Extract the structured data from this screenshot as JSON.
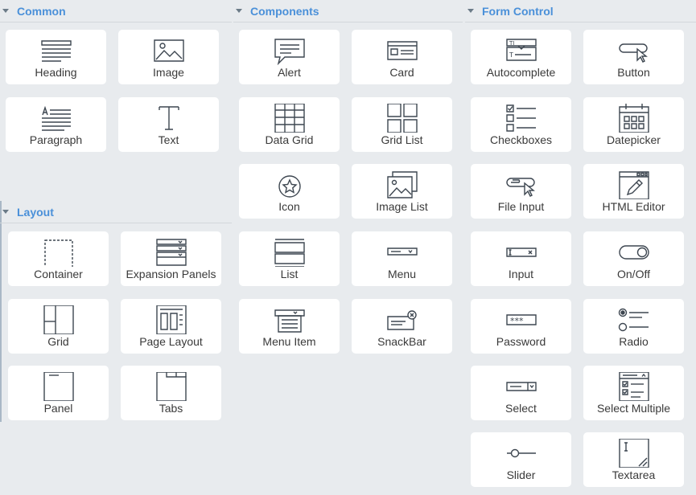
{
  "sections": {
    "common": "Common",
    "components": "Components",
    "form_control": "Form Control",
    "layout": "Layout"
  },
  "common": [
    "Heading",
    "Image",
    "Paragraph",
    "Text"
  ],
  "layout": [
    "Container",
    "Expansion Panels",
    "Grid",
    "Page Layout",
    "Panel",
    "Tabs"
  ],
  "components": [
    "Alert",
    "Card",
    "Data Grid",
    "Grid List",
    "Icon",
    "Image List",
    "List",
    "Menu",
    "Menu Item",
    "SnackBar"
  ],
  "form_control": [
    "Autocomplete",
    "Button",
    "Checkboxes",
    "Datepicker",
    "File Input",
    "HTML Editor",
    "Input",
    "On/Off",
    "Password",
    "Radio",
    "Select",
    "Select Multiple",
    "Slider",
    "Textarea"
  ],
  "icons": {
    "caret": "caret-down-icon",
    "card_icon_color": "#3d4650"
  }
}
